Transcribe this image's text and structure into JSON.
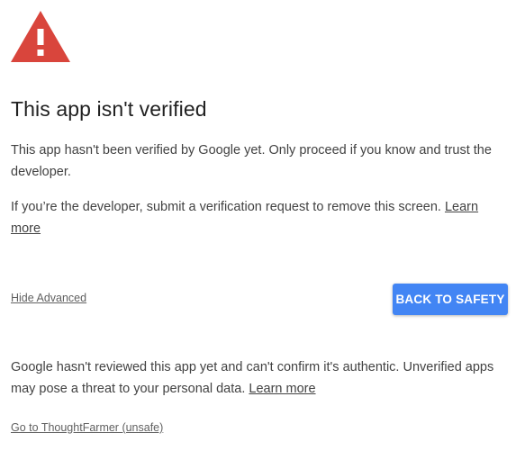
{
  "icon": {
    "name": "warning-triangle-icon",
    "color": "#d9453c"
  },
  "title": "This app isn't verified",
  "intro": {
    "text": "This app hasn't been verified by Google yet. Only proceed if you know and trust the developer."
  },
  "developer_note": {
    "text": "If you’re the developer, submit a verification request to remove this screen. ",
    "link_label": "Learn more"
  },
  "actions": {
    "hide_advanced_label": "Hide Advanced",
    "back_to_safety_label": "BACK TO SAFETY",
    "button_color": "#4285f4"
  },
  "advanced": {
    "text": "Google hasn't reviewed this app yet and can't confirm it's authentic. Unverified apps may pose a threat to your personal data. ",
    "link_label": "Learn more",
    "proceed_label": "Go to ThoughtFarmer (unsafe)"
  }
}
